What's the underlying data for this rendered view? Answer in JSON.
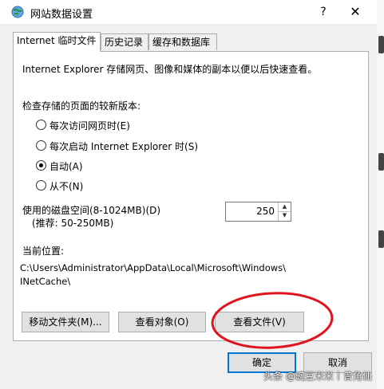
{
  "window": {
    "title": "网站数据设置",
    "help_symbol": "?",
    "close_symbol": "✕"
  },
  "tabs": [
    {
      "label": "Internet 临时文件",
      "active": true
    },
    {
      "label": "历史记录",
      "active": false
    },
    {
      "label": "缓存和数据库",
      "active": false
    }
  ],
  "content": {
    "description": "Internet Explorer 存储网页、图像和媒体的副本以便以后快速查看。",
    "check_label": "检查存储的页面的较新版本:",
    "radios": [
      {
        "label": "每次访问网页时(E)",
        "checked": false
      },
      {
        "label": "每次启动 Internet Explorer 时(S)",
        "checked": false
      },
      {
        "label": "自动(A)",
        "checked": true
      },
      {
        "label": "从不(N)",
        "checked": false
      }
    ],
    "disk_space_label": "使用的磁盘空间(8-1024MB)(D)",
    "disk_space_hint": "(推荐: 50-250MB)",
    "disk_space_value": "250",
    "current_location_label": "当前位置:",
    "path_line1": "C:\\Users\\Administrator\\AppData\\Local\\Microsoft\\Windows\\",
    "path_line2": "INetCache\\",
    "buttons": {
      "move_folder": "移动文件夹(M)...",
      "view_objects": "查看对象(O)",
      "view_files": "查看文件(V)"
    }
  },
  "footer": {
    "ok": "确定",
    "cancel": "取消"
  },
  "watermark": "头条 @豌豆米米丨曾角仙",
  "colors": {
    "annotation": "#e0141e",
    "accent": "#0078d7"
  }
}
